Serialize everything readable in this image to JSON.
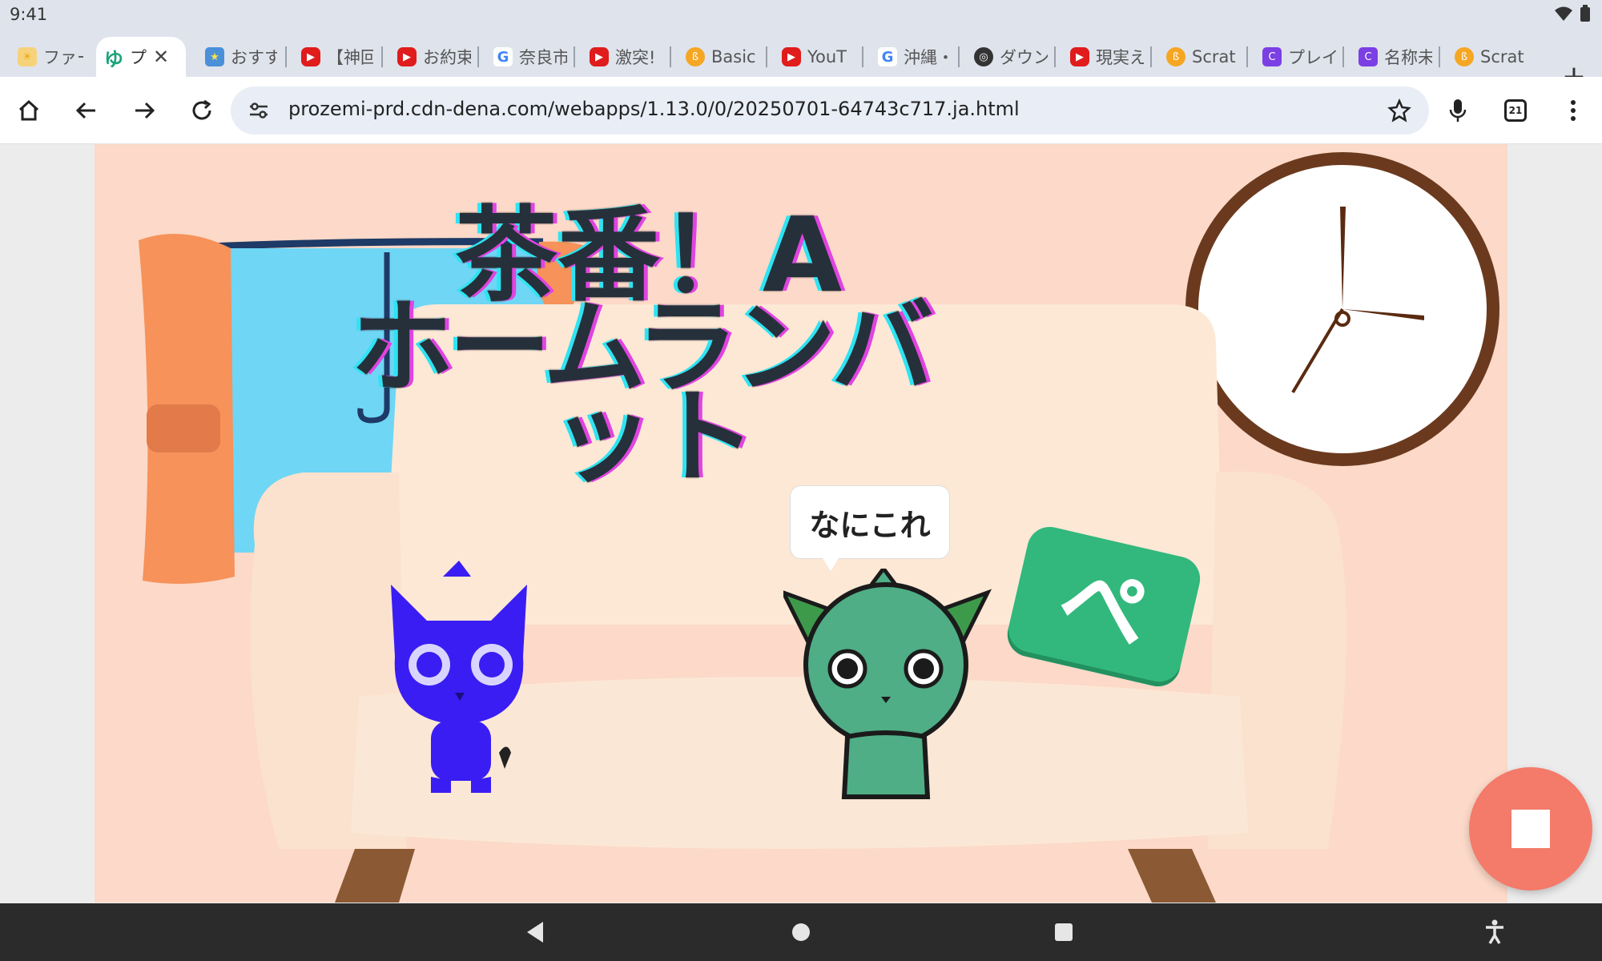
{
  "status_bar": {
    "time": "9:41",
    "icons": [
      "wifi-icon",
      "battery-icon"
    ]
  },
  "tabs": [
    {
      "label": "ファー",
      "favicon": "sun-icon",
      "color": "#f2b84a"
    },
    {
      "label": "プ",
      "favicon": "prozemi-icon",
      "color": "#1aa37a",
      "active": true
    },
    {
      "label": "おすす",
      "favicon": "star-icon",
      "color": "#4a90d9"
    },
    {
      "label": "【神回",
      "favicon": "youtube-icon",
      "color": "#e01c1c"
    },
    {
      "label": "お約束",
      "favicon": "youtube-icon",
      "color": "#e01c1c"
    },
    {
      "label": "奈良市",
      "favicon": "google-icon",
      "color": "#4285f4"
    },
    {
      "label": "激突!",
      "favicon": "youtube-icon",
      "color": "#e01c1c"
    },
    {
      "label": "Basic",
      "favicon": "scratch-icon",
      "color": "#f5a623"
    },
    {
      "label": "YouT",
      "favicon": "youtube-icon",
      "color": "#e01c1c"
    },
    {
      "label": "沖縄・",
      "favicon": "google-icon",
      "color": "#4285f4"
    },
    {
      "label": "ダウン",
      "favicon": "chrome-icon",
      "color": "#333333"
    },
    {
      "label": "現実え",
      "favicon": "youtube-icon",
      "color": "#e01c1c"
    },
    {
      "label": "Scrat",
      "favicon": "scratch-icon",
      "color": "#f5a623"
    },
    {
      "label": "プレイ",
      "favicon": "canva-icon",
      "color": "#7b3fe4"
    },
    {
      "label": "名称未",
      "favicon": "canva-icon",
      "color": "#7b3fe4"
    },
    {
      "label": "Scrat",
      "favicon": "scratch-icon",
      "color": "#f5a623"
    }
  ],
  "toolbar": {
    "url": "prozemi-prd.cdn-dena.com/webapps/1.13.0/0/20250701-64743c717.ja.html",
    "tab_count": "21"
  },
  "game": {
    "title_line1": "茶番！A",
    "title_line2": "ホームランバ",
    "title_line3": "ット",
    "speech_bubble": "なにこれ",
    "pe_sign": "ぺ",
    "colors": {
      "wall": "#fcd9c8",
      "sofa": "#fbe6d6",
      "character_green": "#4fae86",
      "character_blue": "#3a1df2",
      "accent": "#f47a6a"
    }
  },
  "nav": {
    "buttons": [
      "back-icon",
      "home-icon",
      "recents-icon",
      "accessibility-icon"
    ]
  }
}
